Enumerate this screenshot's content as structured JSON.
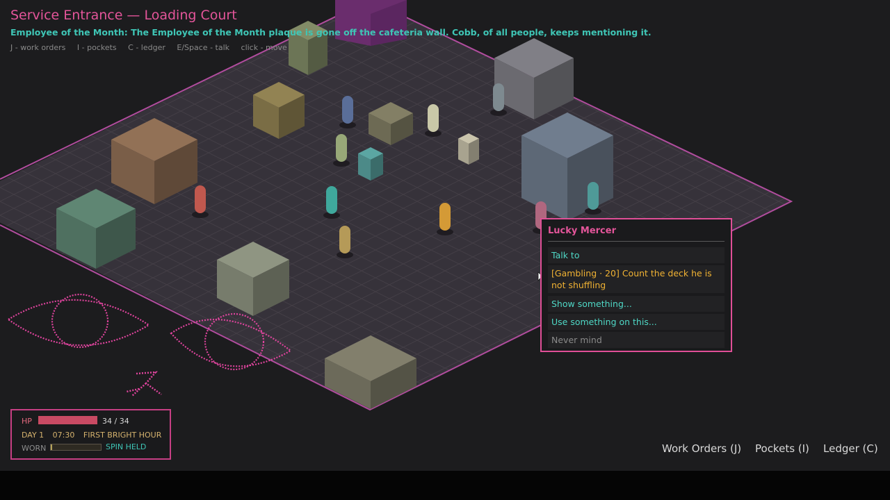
{
  "location": {
    "title": "Service Entrance — Loading Court",
    "subtitle": "Employee of the Month: The Employee of the Month plaque is gone off the cafeteria wall. Cobb, of all people, keeps mentioning it."
  },
  "hints": [
    "J - work orders",
    "I - pockets",
    "C - ledger",
    "E/Space - talk",
    "click - move"
  ],
  "context_menu": {
    "npc_name": "Lucky Mercer",
    "options": [
      {
        "label": "Talk to",
        "kind": "normal"
      },
      {
        "label": "[Gambling · 20] Count the deck he is not shuffling",
        "kind": "check"
      },
      {
        "label": "Show something...",
        "kind": "normal"
      },
      {
        "label": "Use something on this...",
        "kind": "normal"
      },
      {
        "label": "Never mind",
        "kind": "muted"
      }
    ]
  },
  "status": {
    "hp_label": "HP",
    "hp_current": 34,
    "hp_max": 34,
    "hp_text": "34 / 34",
    "day": "DAY 1",
    "time": "07:30",
    "period": "FIRST BRIGHT HOUR",
    "worn_label": "WORN",
    "worn_fraction": 0.03,
    "spin_status": "SPIN HELD"
  },
  "bottom_buttons": {
    "work_orders": "Work Orders (J)",
    "pockets": "Pockets (I)",
    "ledger": "Ledger (C)"
  },
  "colors": {
    "accent_pink": "#e04f97",
    "teal_text": "#4fd8c6",
    "check_text": "#f0b233",
    "hp_bar": "#c94a63",
    "floor": "#3a3539",
    "floor_edge": "#b04a9a"
  },
  "icons": {
    "watching_eye_left": "eye-icon",
    "watching_eye_right": "eye-icon",
    "running_figure": "running-figure-icon"
  }
}
